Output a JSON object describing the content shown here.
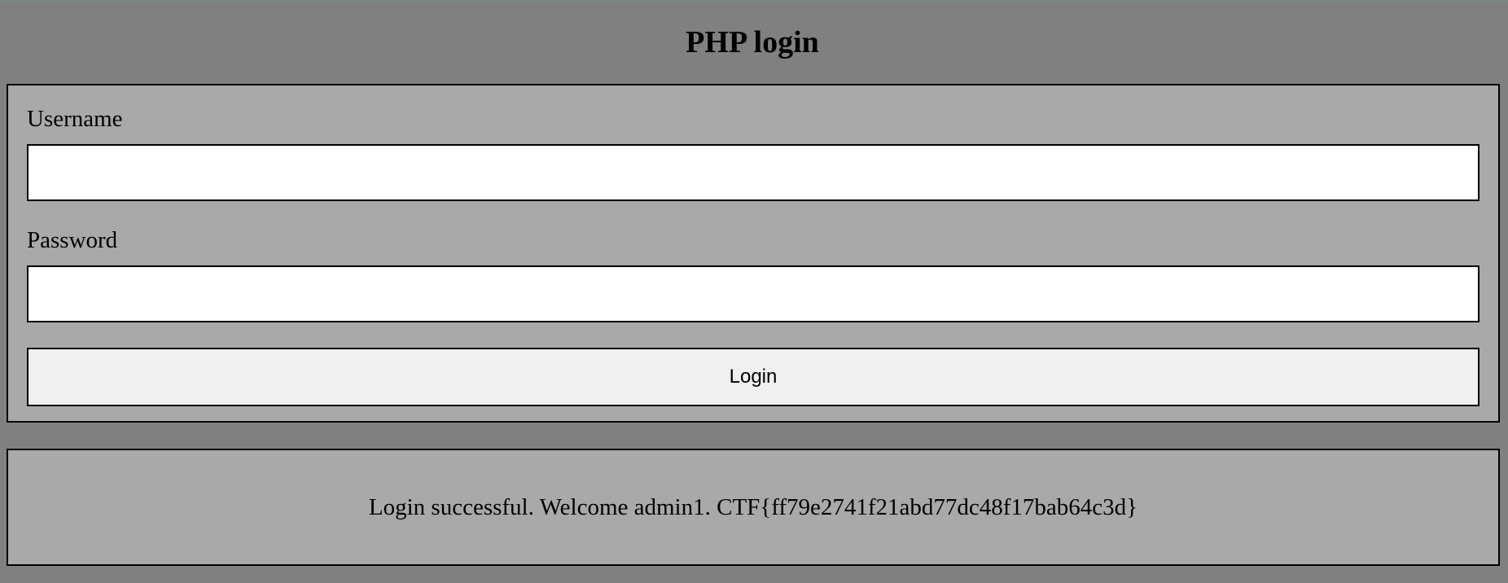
{
  "page": {
    "title": "PHP login"
  },
  "form": {
    "username_label": "Username",
    "username_value": "",
    "password_label": "Password",
    "password_value": "",
    "login_label": "Login"
  },
  "message": {
    "text": "Login successful. Welcome admin1. CTF{ff79e2741f21abd77dc48f17bab64c3d}"
  },
  "colors": {
    "page_background": "#808080",
    "panel_background": "#a9a9a9",
    "input_background": "#ffffff",
    "button_background": "#f0f0f0",
    "border": "#000000"
  }
}
